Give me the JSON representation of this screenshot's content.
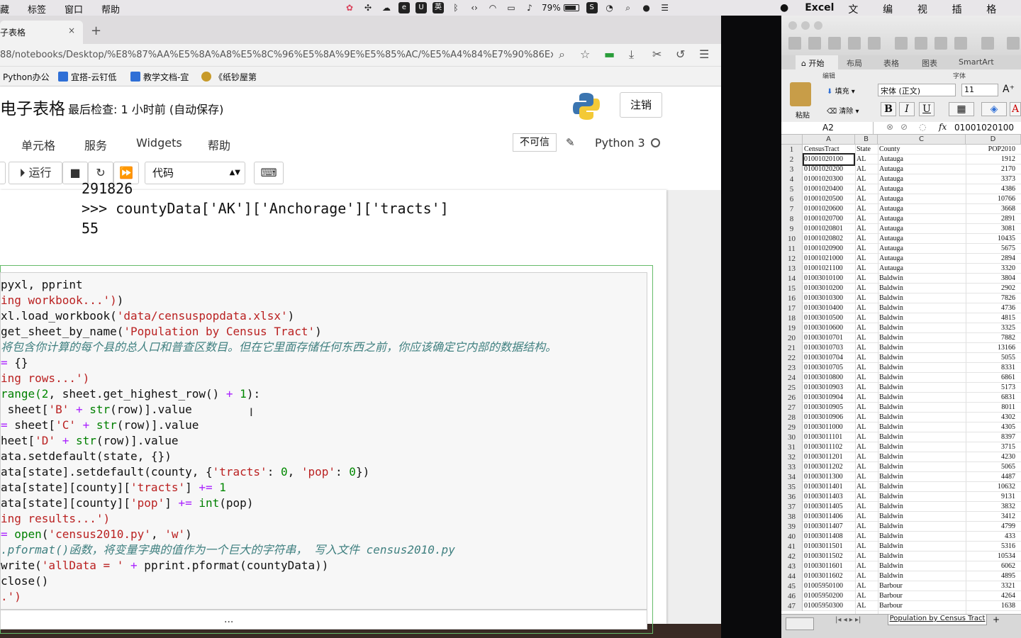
{
  "menubar": {
    "items": [
      "藏",
      "标签",
      "窗口",
      "帮助"
    ],
    "battery": "79%",
    "excel_app": "Excel",
    "excel_items": [
      "文件",
      "编辑",
      "视图",
      "插入",
      "格式"
    ]
  },
  "browser": {
    "tab_title": "子表格",
    "url": "88/notebooks/Desktop/%E8%87%AA%E5%8A%A8%E5%8C%96%E5%8A%9E%E5%85%AC/%E5%A4%84%E7%90%86Ex",
    "bookmarks": [
      "Python办公",
      "宜搭-云钉低",
      "教学文档-宜",
      "《纸钞屋第"
    ]
  },
  "jupyter": {
    "title": "电子表格",
    "checkpoint": "最后检查: 1 小时前  (自动保存)",
    "logout": "注销",
    "menus": [
      "单元格",
      "服务",
      "Widgets",
      "帮助"
    ],
    "trusted": "不可信",
    "kernel": "Python 3",
    "run_label": "运行",
    "cell_type": "代码"
  },
  "output": {
    "line0": "291826",
    "line1": ">>> countyData['AK']['Anchorage']['tracts']",
    "line2": "55"
  },
  "code": {
    "l0a": "pyxl, pprint",
    "l1a": "ing ",
    "l1b": "workbook...')",
    "l1pre": ")",
    "l2a": "xl.load_workbook(",
    "l2b": "'data/censuspopdata.xlsx'",
    "l2c": ")",
    "l3a": "get_sheet_by_name(",
    "l3b": "'Population by Census Tract'",
    "l3c": ")",
    "l4": "将包含你计算的每个县的总人口和普查区数目。但在它里面存储任何东西之前，你应该确定它内部的数据结构。",
    "l5a": "= ",
    "l5b": "{}",
    "l6a": "ing rows...')",
    "l7a": "range(",
    "l7b": "2",
    "l7c": ", sheet.get_highest_row() ",
    "l7d": "+",
    "l7e": " ",
    "l7f": "1",
    "l7g": "):",
    "l8a": " sheet[",
    "l8b": "'B'",
    "l8c": " ",
    "l8d": "+",
    "l8e": " ",
    "l8f": "str",
    "l8g": "(row)].value",
    "l9a": "= ",
    "l9b": "sheet[",
    "l9c": "'C'",
    "l9d": " ",
    "l9e": "+",
    "l9f": " ",
    "l9g": "str",
    "l9h": "(row)].value",
    "l10a": "heet[",
    "l10b": "'D'",
    "l10c": " ",
    "l10d": "+",
    "l10e": " ",
    "l10f": "str",
    "l10g": "(row)].value",
    "l11a": "ata.setdefault(state, {})",
    "l12a": "ata[state].setdefault(county, {",
    "l12b": "'tracts'",
    "l12c": ": ",
    "l12d": "0",
    "l12e": ", ",
    "l12f": "'pop'",
    "l12g": ": ",
    "l12h": "0",
    "l12i": "})",
    "l13a": "ata[state][county][",
    "l13b": "'tracts'",
    "l13c": "] ",
    "l13d": "+=",
    "l13e": " ",
    "l13f": "1",
    "l14a": "ata[state][county][",
    "l14b": "'pop'",
    "l14c": "] ",
    "l14d": "+=",
    "l14e": " ",
    "l14f": "int",
    "l14g": "(pop)",
    "l15a": "ing results...')",
    "l16a": "= ",
    "l16b": "open",
    "l16c": "(",
    "l16d": "'census2010.py'",
    "l16e": ", ",
    "l16f": "'w'",
    "l16g": ")",
    "l17": ".pformat()函数，将变量字典的值作为一个巨大的字符串， 写入文件 census2010.py",
    "l18a": "write(",
    "l18b": "'allData = '",
    "l18c": " ",
    "l18d": "+",
    "l18e": " pprint.pformat(countyData))",
    "l19a": "close()",
    "l20a": ".')",
    "dots": "..."
  },
  "excel": {
    "ribbon_tabs": [
      "开始",
      "布局",
      "表格",
      "图表",
      "SmartArt"
    ],
    "group_edit": "编辑",
    "group_font": "字体",
    "paste": "粘贴",
    "fill": "填充",
    "clear": "清除",
    "font_name": "宋体 (正文)",
    "font_size": "11",
    "bold": "B",
    "italic": "I",
    "underline": "U",
    "name_box": "A2",
    "fx": "fx",
    "formula_value": "01001020100",
    "columns": [
      "A",
      "B",
      "C",
      "D"
    ],
    "sheet_tab": "Population by Census Tract",
    "rows": [
      [
        "1",
        "CensusTract",
        "State",
        "County",
        "POP2010"
      ],
      [
        "2",
        "01001020100",
        "AL",
        "Autauga",
        "1912"
      ],
      [
        "3",
        "01001020200",
        "AL",
        "Autauga",
        "2170"
      ],
      [
        "4",
        "01001020300",
        "AL",
        "Autauga",
        "3373"
      ],
      [
        "5",
        "01001020400",
        "AL",
        "Autauga",
        "4386"
      ],
      [
        "6",
        "01001020500",
        "AL",
        "Autauga",
        "10766"
      ],
      [
        "7",
        "01001020600",
        "AL",
        "Autauga",
        "3668"
      ],
      [
        "8",
        "01001020700",
        "AL",
        "Autauga",
        "2891"
      ],
      [
        "9",
        "01001020801",
        "AL",
        "Autauga",
        "3081"
      ],
      [
        "10",
        "01001020802",
        "AL",
        "Autauga",
        "10435"
      ],
      [
        "11",
        "01001020900",
        "AL",
        "Autauga",
        "5675"
      ],
      [
        "12",
        "01001021000",
        "AL",
        "Autauga",
        "2894"
      ],
      [
        "13",
        "01001021100",
        "AL",
        "Autauga",
        "3320"
      ],
      [
        "14",
        "01003010100",
        "AL",
        "Baldwin",
        "3804"
      ],
      [
        "15",
        "01003010200",
        "AL",
        "Baldwin",
        "2902"
      ],
      [
        "16",
        "01003010300",
        "AL",
        "Baldwin",
        "7826"
      ],
      [
        "17",
        "01003010400",
        "AL",
        "Baldwin",
        "4736"
      ],
      [
        "18",
        "01003010500",
        "AL",
        "Baldwin",
        "4815"
      ],
      [
        "19",
        "01003010600",
        "AL",
        "Baldwin",
        "3325"
      ],
      [
        "20",
        "01003010701",
        "AL",
        "Baldwin",
        "7882"
      ],
      [
        "21",
        "01003010703",
        "AL",
        "Baldwin",
        "13166"
      ],
      [
        "22",
        "01003010704",
        "AL",
        "Baldwin",
        "5055"
      ],
      [
        "23",
        "01003010705",
        "AL",
        "Baldwin",
        "8331"
      ],
      [
        "24",
        "01003010800",
        "AL",
        "Baldwin",
        "6861"
      ],
      [
        "25",
        "01003010903",
        "AL",
        "Baldwin",
        "5173"
      ],
      [
        "26",
        "01003010904",
        "AL",
        "Baldwin",
        "6831"
      ],
      [
        "27",
        "01003010905",
        "AL",
        "Baldwin",
        "8011"
      ],
      [
        "28",
        "01003010906",
        "AL",
        "Baldwin",
        "4302"
      ],
      [
        "29",
        "01003011000",
        "AL",
        "Baldwin",
        "4305"
      ],
      [
        "30",
        "01003011101",
        "AL",
        "Baldwin",
        "8397"
      ],
      [
        "31",
        "01003011102",
        "AL",
        "Baldwin",
        "3715"
      ],
      [
        "32",
        "01003011201",
        "AL",
        "Baldwin",
        "4230"
      ],
      [
        "33",
        "01003011202",
        "AL",
        "Baldwin",
        "5065"
      ],
      [
        "34",
        "01003011300",
        "AL",
        "Baldwin",
        "4487"
      ],
      [
        "35",
        "01003011401",
        "AL",
        "Baldwin",
        "10632"
      ],
      [
        "36",
        "01003011403",
        "AL",
        "Baldwin",
        "9131"
      ],
      [
        "37",
        "01003011405",
        "AL",
        "Baldwin",
        "3832"
      ],
      [
        "38",
        "01003011406",
        "AL",
        "Baldwin",
        "3412"
      ],
      [
        "39",
        "01003011407",
        "AL",
        "Baldwin",
        "4799"
      ],
      [
        "40",
        "01003011408",
        "AL",
        "Baldwin",
        "433"
      ],
      [
        "41",
        "01003011501",
        "AL",
        "Baldwin",
        "5316"
      ],
      [
        "42",
        "01003011502",
        "AL",
        "Baldwin",
        "10534"
      ],
      [
        "43",
        "01003011601",
        "AL",
        "Baldwin",
        "6062"
      ],
      [
        "44",
        "01003011602",
        "AL",
        "Baldwin",
        "4895"
      ],
      [
        "45",
        "01005950100",
        "AL",
        "Barbour",
        "3321"
      ],
      [
        "46",
        "01005950200",
        "AL",
        "Barbour",
        "4264"
      ],
      [
        "47",
        "01005950300",
        "AL",
        "Barbour",
        "1638"
      ]
    ]
  }
}
